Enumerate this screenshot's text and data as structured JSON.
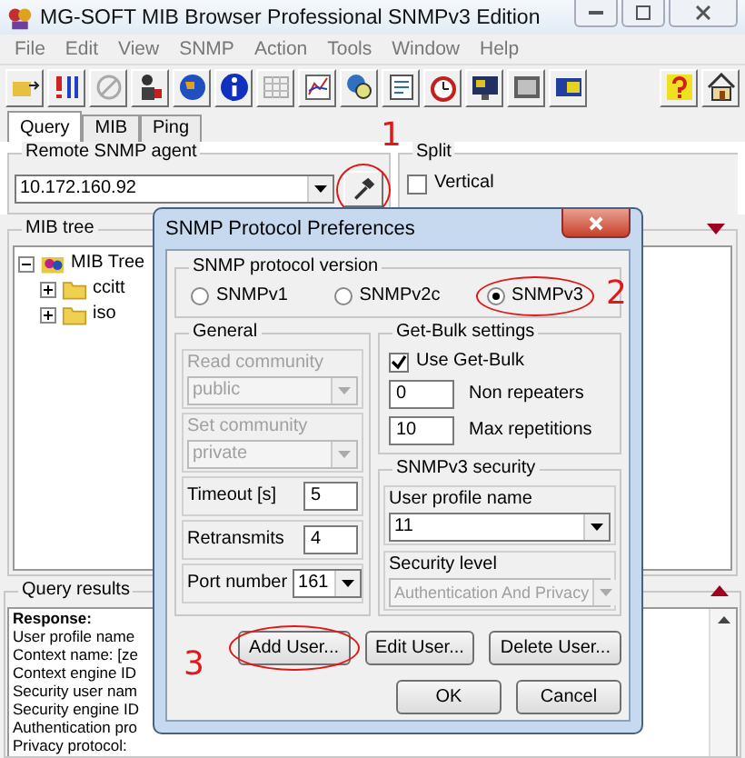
{
  "window": {
    "title": "MG-SOFT MIB Browser Professional SNMPv3 Edition"
  },
  "menu": [
    "File",
    "Edit",
    "View",
    "SNMP",
    "Action",
    "Tools",
    "Window",
    "Help"
  ],
  "tabs": [
    {
      "label": "Query",
      "selected": true
    },
    {
      "label": "MIB",
      "selected": false
    },
    {
      "label": "Ping",
      "selected": false
    }
  ],
  "remote_agent": {
    "label": "Remote SNMP agent",
    "value": "10.172.160.92",
    "split_label": "Split",
    "vertical": {
      "label": "Vertical",
      "checked": false
    }
  },
  "mib_tree": {
    "label": "MIB tree",
    "items": [
      {
        "label": "MIB Tree",
        "expanded": true,
        "children": [
          {
            "label": "ccitt",
            "expanded": false
          },
          {
            "label": "iso",
            "expanded": false
          }
        ]
      }
    ]
  },
  "query_results": {
    "label": "Query results",
    "lines": [
      "Response:",
      "User profile name",
      "Context name: [ze",
      "Context engine ID",
      "Security user nam",
      "Security engine ID",
      "Authentication pro",
      "Privacy protocol: "
    ]
  },
  "dialog": {
    "title": "SNMP Protocol Preferences",
    "version": {
      "label": "SNMP protocol version",
      "options": [
        {
          "label": "SNMPv1",
          "selected": false
        },
        {
          "label": "SNMPv2c",
          "selected": false
        },
        {
          "label": "SNMPv3",
          "selected": true
        }
      ]
    },
    "general": {
      "label": "General",
      "fields": [
        {
          "kind": "stacked-combo",
          "label": "Read community",
          "value": "public",
          "disabled": true
        },
        {
          "kind": "stacked-combo",
          "label": "Set community",
          "value": "private",
          "disabled": true
        },
        {
          "kind": "inline-text",
          "label": "Timeout [s]",
          "value": "5",
          "disabled": false
        },
        {
          "kind": "inline-text",
          "label": "Retransmits",
          "value": "4",
          "disabled": false
        },
        {
          "kind": "inline-combo",
          "label": "Port number",
          "value": "161",
          "disabled": false
        }
      ]
    },
    "get_bulk": {
      "label": "Get-Bulk settings",
      "use": {
        "label": "Use Get-Bulk",
        "checked": true
      },
      "fields": [
        {
          "value": "0",
          "label": "Non repeaters"
        },
        {
          "value": "10",
          "label": "Max repetitions"
        }
      ]
    },
    "security": {
      "label": "SNMPv3 security",
      "profile": {
        "label": "User profile name",
        "value": "11"
      },
      "level": {
        "label": "Security level",
        "value": "Authentication And Privacy",
        "disabled": true
      }
    },
    "user_buttons": [
      "Add User...",
      "Edit User...",
      "Delete User..."
    ],
    "action_buttons": [
      "OK",
      "Cancel"
    ]
  },
  "annotations": [
    {
      "label": "1"
    },
    {
      "label": "2"
    },
    {
      "label": "3"
    }
  ]
}
